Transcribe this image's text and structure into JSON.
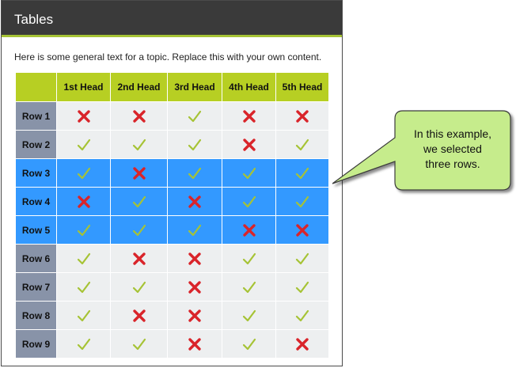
{
  "header": {
    "title": "Tables"
  },
  "intro_text": "Here is some general text for a topic. Replace this with your own content.",
  "table": {
    "columns": [
      "",
      "1st Head",
      "2nd Head",
      "3rd Head",
      "4th Head",
      "5th Head"
    ],
    "rows": [
      {
        "label": "Row 1",
        "selected": false,
        "cells": [
          "cross",
          "cross",
          "check",
          "cross",
          "cross"
        ]
      },
      {
        "label": "Row 2",
        "selected": false,
        "cells": [
          "check",
          "check",
          "check",
          "cross",
          "check"
        ]
      },
      {
        "label": "Row 3",
        "selected": true,
        "cells": [
          "check",
          "cross",
          "check",
          "check",
          "check"
        ]
      },
      {
        "label": "Row 4",
        "selected": true,
        "cells": [
          "cross",
          "check",
          "cross",
          "check",
          "check"
        ]
      },
      {
        "label": "Row 5",
        "selected": true,
        "cells": [
          "check",
          "check",
          "check",
          "cross",
          "cross"
        ]
      },
      {
        "label": "Row 6",
        "selected": false,
        "cells": [
          "check",
          "cross",
          "cross",
          "check",
          "check"
        ]
      },
      {
        "label": "Row 7",
        "selected": false,
        "cells": [
          "check",
          "check",
          "cross",
          "check",
          "check"
        ]
      },
      {
        "label": "Row 8",
        "selected": false,
        "cells": [
          "check",
          "cross",
          "cross",
          "check",
          "check"
        ]
      },
      {
        "label": "Row 9",
        "selected": false,
        "cells": [
          "check",
          "check",
          "cross",
          "check",
          "cross"
        ]
      }
    ]
  },
  "callout": {
    "lines": [
      "In this example,",
      "we selected",
      "three rows."
    ]
  },
  "colors": {
    "header_bg": "#3a3a3a",
    "accent": "#b7cf23",
    "selected_row": "#3399ff",
    "row_label": "#8893a8",
    "cell_bg": "#edeff0",
    "check": "#a6c335",
    "cross": "#d9242a",
    "callout_fill": "#c6ec8c"
  }
}
